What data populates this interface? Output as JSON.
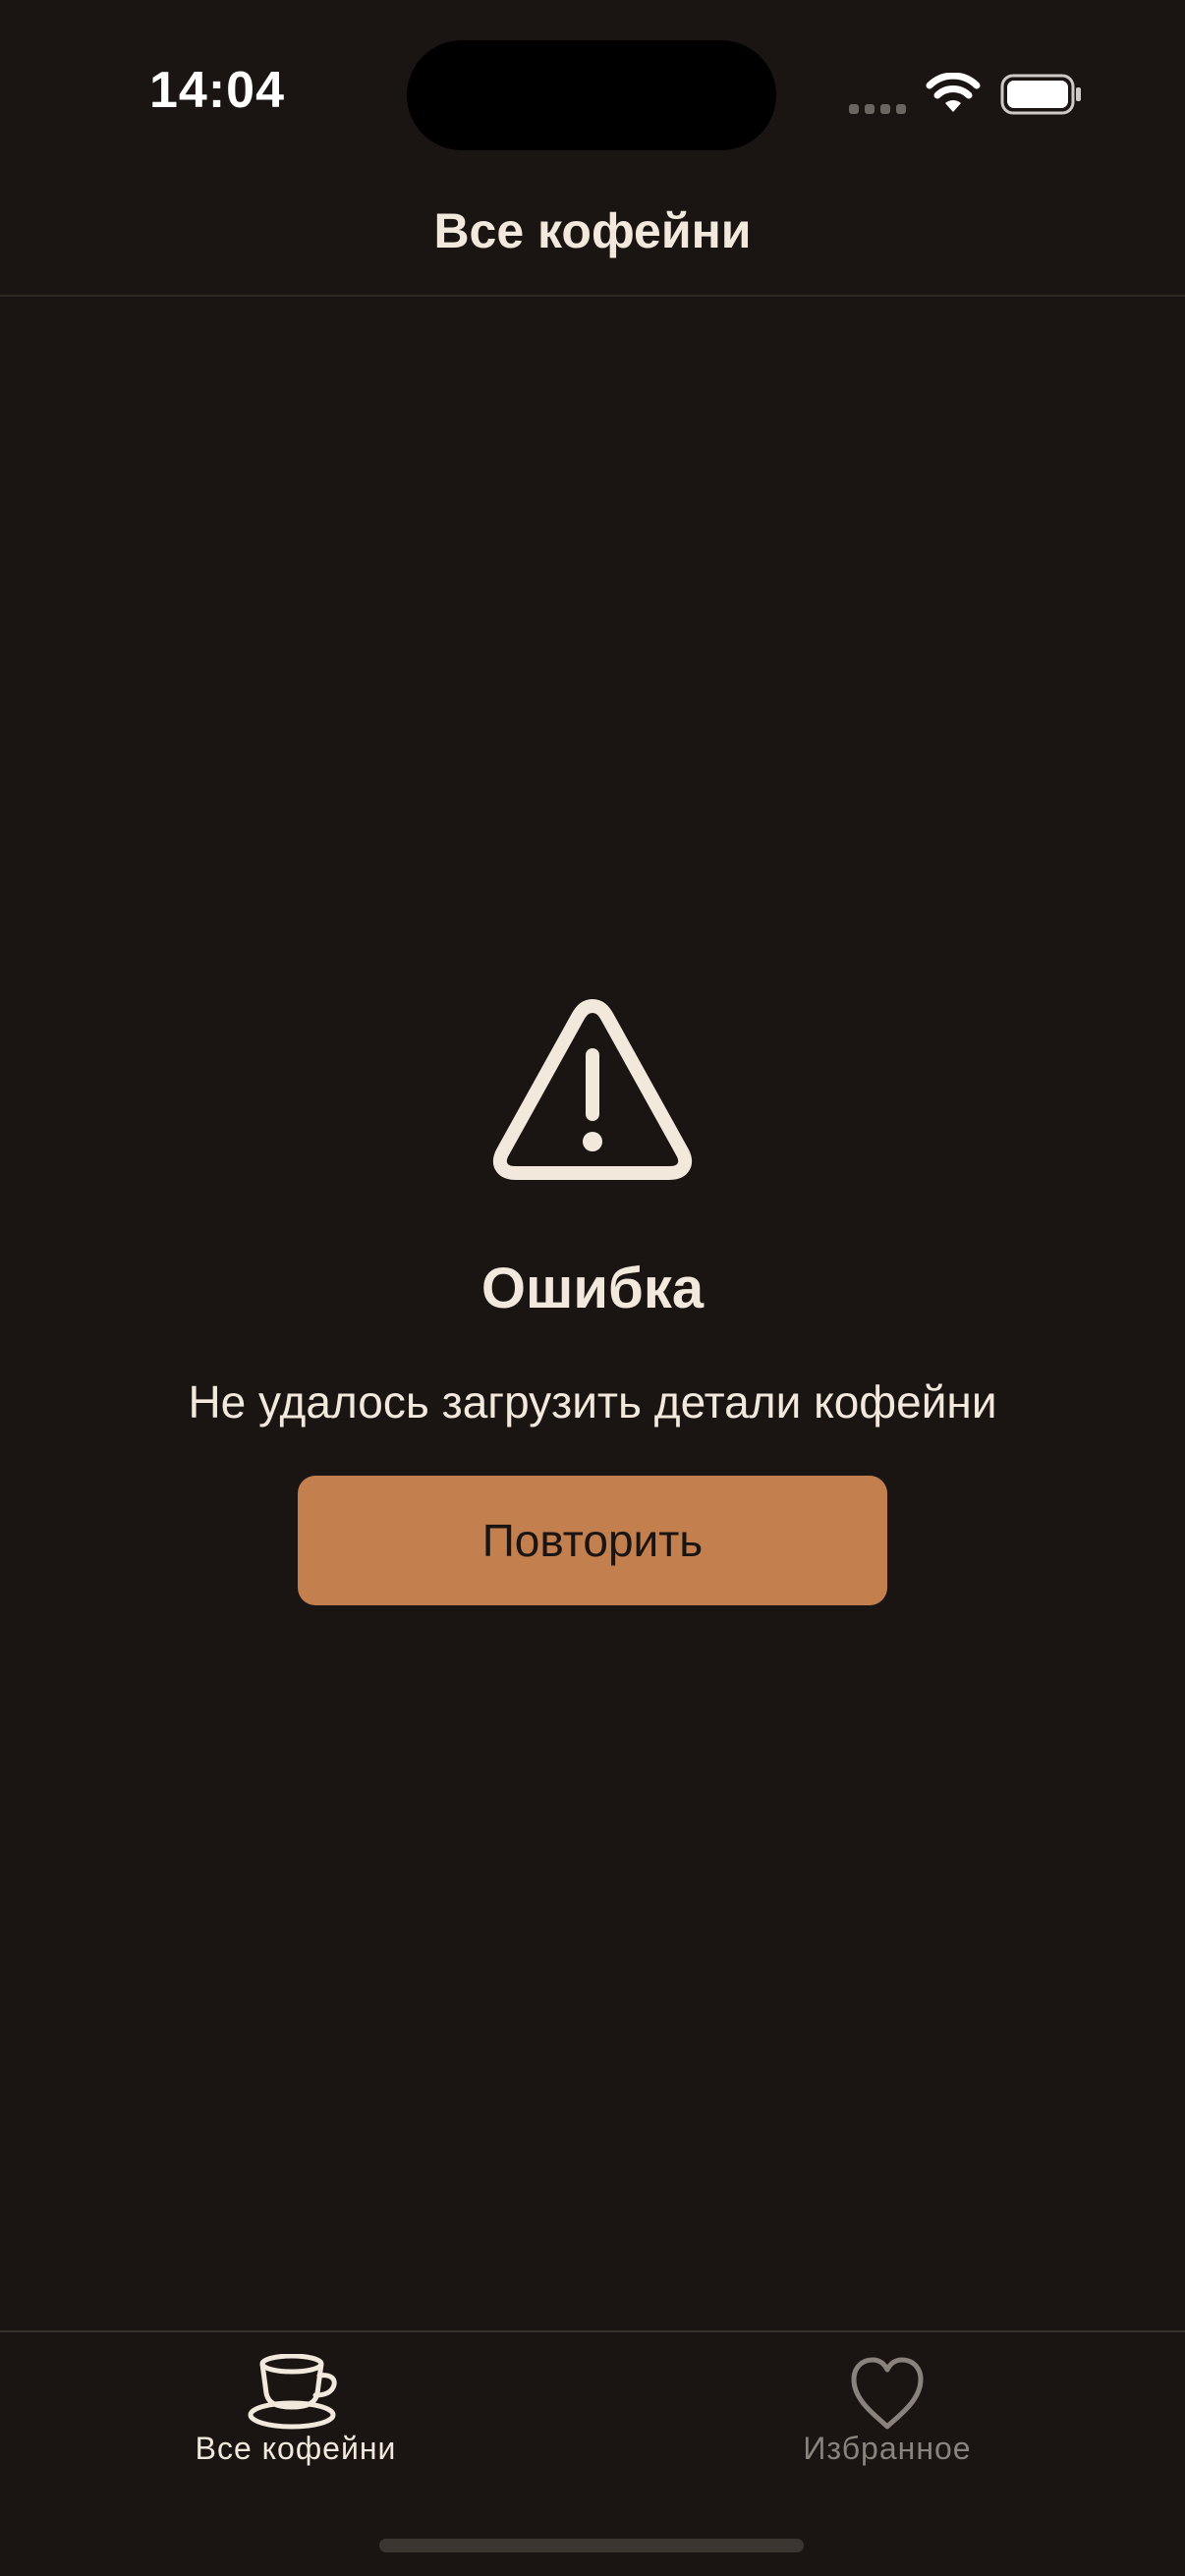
{
  "status_bar": {
    "time": "14:04",
    "icons": [
      "cellular-signal-icon",
      "wifi-icon",
      "battery-icon"
    ]
  },
  "nav": {
    "title": "Все кофейни"
  },
  "error": {
    "icon": "warning-triangle-icon",
    "title": "Ошибка",
    "message": "Не удалось загрузить детали кофейни",
    "retry_label": "Повторить"
  },
  "tab_bar": {
    "tabs": [
      {
        "label": "Все кофейни",
        "icon": "coffee-cup-icon",
        "selected": true
      },
      {
        "label": "Избранное",
        "icon": "heart-icon",
        "selected": false
      }
    ]
  },
  "colors": {
    "background": "#1a1512",
    "text_primary": "#f2e8dc",
    "accent": "#c47f4e",
    "tab_inactive": "#8a837d"
  }
}
